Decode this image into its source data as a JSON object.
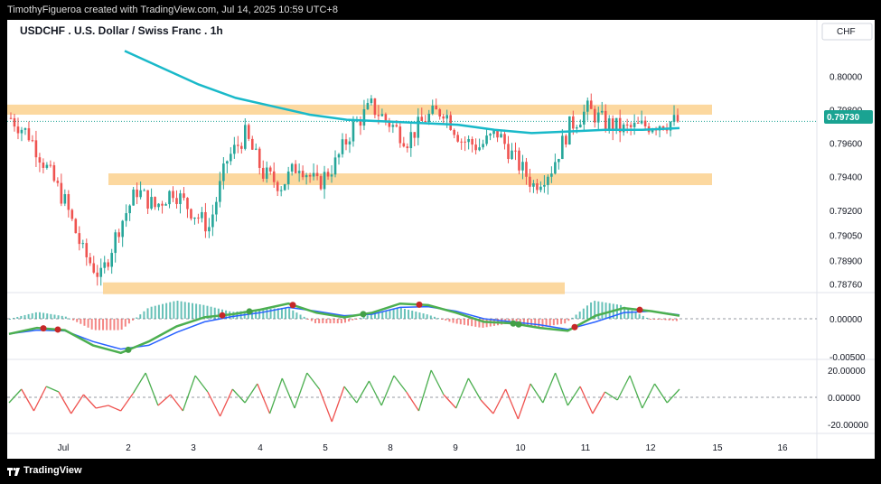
{
  "header": {
    "attribution": "TimothyFigueroa created with TradingView.com, Jul 14, 2025 10:59 UTC+8"
  },
  "footer": {
    "brand": "TradingView"
  },
  "chart_data": {
    "type": "candlestick",
    "title": "USDCHF . U.S. Dollar / Swiss Franc . 1h",
    "currency_label": "CHF",
    "last_price": "0.79730",
    "price_axis": {
      "ticks": [
        "0.80000",
        "0.79800",
        "0.79600",
        "0.79400",
        "0.79200",
        "0.79050",
        "0.78900",
        "0.78760"
      ]
    },
    "x_axis": {
      "ticks": [
        "Jul",
        "2",
        "3",
        "4",
        "5",
        "8",
        "9",
        "10",
        "11",
        "12",
        "15",
        "16"
      ]
    },
    "zones": [
      {
        "from": 0.7977,
        "to": 0.7983,
        "start": "Jun 30",
        "end": "Jul 14"
      },
      {
        "from": 0.7935,
        "to": 0.7942,
        "start": "Jul 1",
        "end": "Jul 14"
      },
      {
        "from": 0.787,
        "to": 0.7877,
        "start": "Jul 1",
        "end": "Jul 10"
      }
    ],
    "candles_approx_close": [
      0.7975,
      0.7965,
      0.7945,
      0.7925,
      0.7895,
      0.788,
      0.791,
      0.7932,
      0.7922,
      0.7932,
      0.792,
      0.791,
      0.795,
      0.7965,
      0.7942,
      0.7935,
      0.7948,
      0.7935,
      0.7948,
      0.797,
      0.7982,
      0.7972,
      0.7962,
      0.7975,
      0.798,
      0.7962,
      0.7958,
      0.7966,
      0.795,
      0.7935,
      0.7945,
      0.797,
      0.798,
      0.7972,
      0.7968,
      0.797,
      0.7972,
      0.7973
    ],
    "moving_average_approx": [
      0.8015,
      0.8005,
      0.7995,
      0.7987,
      0.7982,
      0.7977,
      0.7974,
      0.7973,
      0.7972,
      0.7971,
      0.7968,
      0.7966,
      0.7967,
      0.7968,
      0.7968,
      0.7969
    ],
    "indicator1": {
      "ticks": [
        "0.00000",
        "-0.00500"
      ],
      "fast_approx": [
        -0.002,
        -0.0012,
        -0.0015,
        -0.0035,
        -0.0045,
        -0.003,
        -0.001,
        0.0002,
        0.0006,
        0.0012,
        0.002,
        0.0008,
        0.0002,
        0.0008,
        0.002,
        0.0018,
        0.0008,
        -0.0004,
        -0.0006,
        -0.0012,
        -0.0016,
        0.0004,
        0.0014,
        0.001,
        0.0004
      ],
      "slow_approx": [
        -0.002,
        -0.0015,
        -0.0016,
        -0.003,
        -0.004,
        -0.0035,
        -0.0018,
        -0.0004,
        0.0003,
        0.0008,
        0.0015,
        0.001,
        0.0004,
        0.0006,
        0.0015,
        0.0016,
        0.001,
        0.0,
        -0.0004,
        -0.0008,
        -0.0014,
        -0.0004,
        0.0008,
        0.001,
        0.0005
      ]
    },
    "indicator2": {
      "ticks": [
        "20.00000",
        "0.00000",
        "-20.00000"
      ],
      "values_approx": [
        -4,
        6,
        -10,
        8,
        4,
        -12,
        2,
        -8,
        -6,
        -10,
        3,
        18,
        -6,
        2,
        -10,
        16,
        4,
        -14,
        6,
        -4,
        10,
        -12,
        14,
        -8,
        18,
        6,
        -18,
        8,
        -4,
        12,
        -6,
        16,
        4,
        -10,
        20,
        2,
        -8,
        14,
        -2,
        -12,
        6,
        -16,
        10,
        -4,
        18,
        -6,
        8,
        -12,
        4,
        -2,
        16,
        -8,
        10,
        -4,
        6
      ]
    }
  }
}
